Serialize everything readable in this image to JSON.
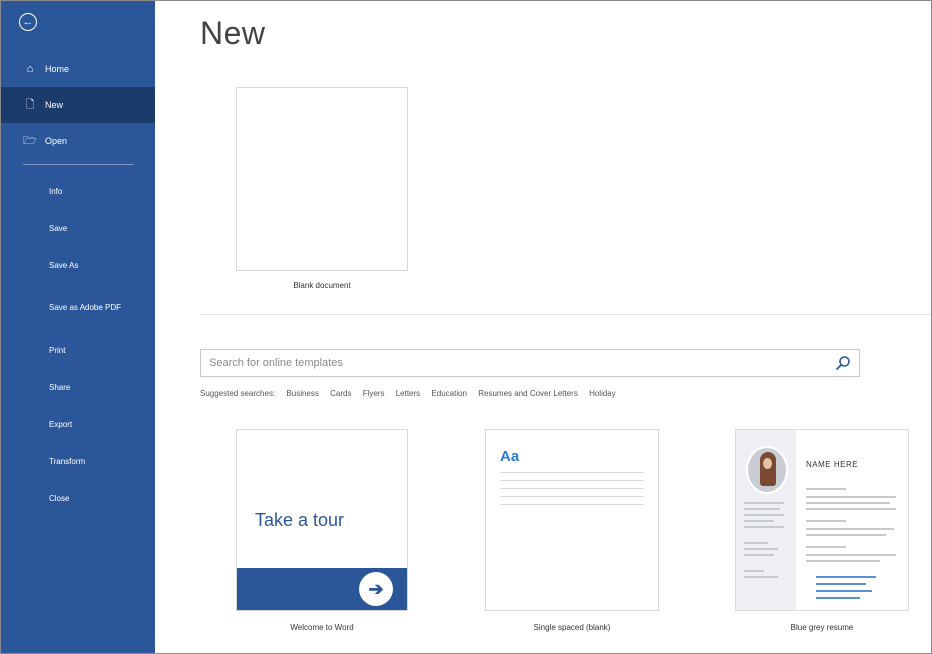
{
  "sidebar": {
    "back_glyph": "←",
    "top_items": [
      {
        "label": "Home",
        "icon": "home-icon",
        "glyph": "⌂"
      },
      {
        "label": "New",
        "icon": "new-doc-icon",
        "glyph": "🗋"
      },
      {
        "label": "Open",
        "icon": "folder-open-icon",
        "glyph": "🗁"
      }
    ],
    "bottom_items": [
      "Info",
      "Save",
      "Save As",
      "Save as Adobe PDF",
      "Print",
      "Share",
      "Export",
      "Transform",
      "Close"
    ]
  },
  "main": {
    "title": "New",
    "blank_document_label": "Blank document",
    "search_placeholder": "Search for online templates",
    "suggested_label": "Suggested searches:",
    "suggested": [
      "Business",
      "Cards",
      "Flyers",
      "Letters",
      "Education",
      "Resumes and Cover Letters",
      "Holiday"
    ],
    "templates": [
      {
        "label": "Welcome to Word",
        "preview_text": "Take a tour",
        "arrow": "➔"
      },
      {
        "label": "Single spaced (blank)",
        "preview_text": "Aa"
      },
      {
        "label": "Blue grey resume",
        "preview_text": "NAME HERE"
      }
    ]
  },
  "colors": {
    "accent": "#2b579a",
    "accent_dark": "#1b3b6b",
    "link_blue": "#2b7cd3"
  }
}
